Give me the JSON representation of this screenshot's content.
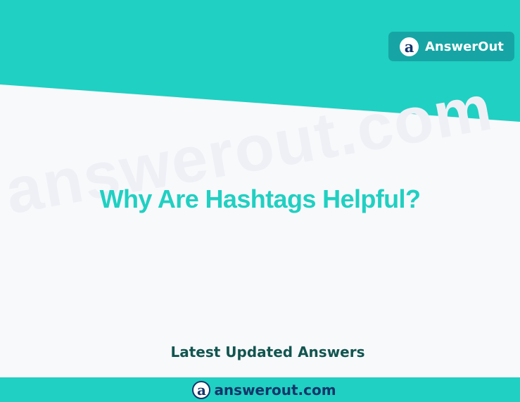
{
  "header": {
    "brand_icon_letter": "a",
    "brand_name": "AnswerOut"
  },
  "watermark": {
    "text": "answerout.com"
  },
  "main": {
    "question_title": "Why Are Hashtags Helpful?",
    "latest_label": "Latest Updated Answers"
  },
  "footer": {
    "icon_letter": "a",
    "site": "answerout.com"
  },
  "colors": {
    "teal": "#20d0c2",
    "dark_teal": "#16a5a4",
    "navy": "#13356a",
    "background": "#f8f9fb"
  }
}
